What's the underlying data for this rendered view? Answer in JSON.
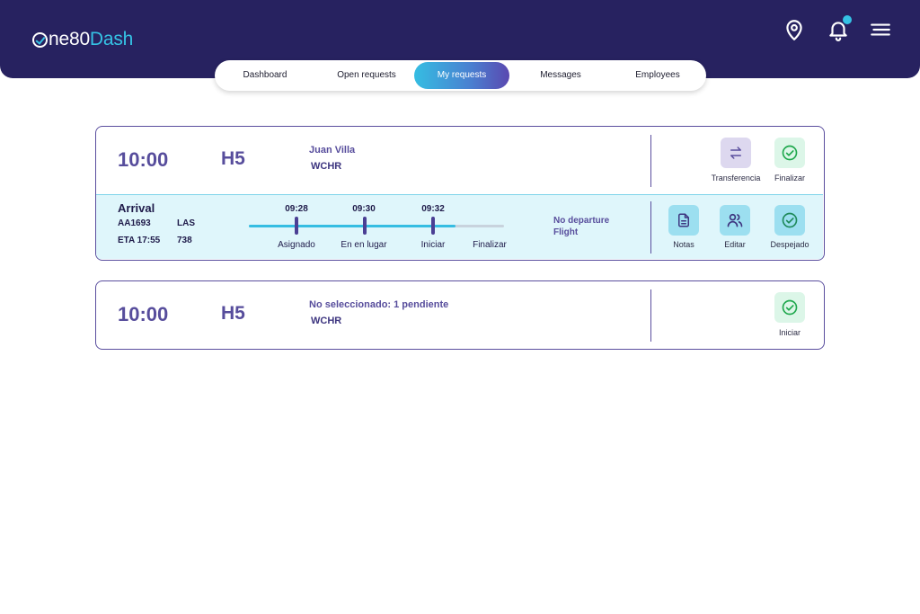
{
  "brand": {
    "logo_part1": "ne80",
    "logo_part2": "Dash"
  },
  "header_icons": {
    "location": "map-pin-icon",
    "notifications": "bell-icon",
    "menu": "hamburger-menu-icon"
  },
  "nav": {
    "tabs": [
      {
        "label": "Dashboard"
      },
      {
        "label": "Open requests"
      },
      {
        "label": "My requests",
        "active": true
      },
      {
        "label": "Messages"
      },
      {
        "label": "Employees"
      }
    ]
  },
  "requests": [
    {
      "time": "10:00",
      "gate": "H5",
      "passenger": "Juan Villa",
      "service": "WCHR",
      "actions": [
        {
          "label": "Transferencia",
          "icon": "transfer-arrows-icon"
        },
        {
          "label": "Finalizar",
          "icon": "check-circle-icon"
        }
      ],
      "detail": {
        "title": "Arrival",
        "flight": "AA1693",
        "origin": "LAS",
        "eta": "ETA 17:55",
        "code": "738",
        "progress_fraction": 0.81,
        "timeline": [
          {
            "time": "09:28",
            "stage": "Asignado"
          },
          {
            "time": "09:30",
            "stage": "En en lugar"
          },
          {
            "time": "09:32",
            "stage": "Iniciar"
          },
          {
            "time": "",
            "stage": "Finalizar"
          }
        ],
        "departure_note_line1": "No departure",
        "departure_note_line2": "Flight",
        "actions": [
          {
            "label": "Notas",
            "icon": "document-icon"
          },
          {
            "label": "Editar",
            "icon": "users-icon"
          },
          {
            "label": "Despejado",
            "icon": "check-circle-icon"
          }
        ]
      }
    },
    {
      "time": "10:00",
      "gate": "H5",
      "passenger": "No seleccionado: 1 pendiente",
      "service": "WCHR",
      "actions": [
        {
          "label": "Iniciar",
          "icon": "check-circle-icon"
        }
      ]
    }
  ],
  "colors": {
    "header_bg": "#272260",
    "accent_cyan": "#35c2e4",
    "card_border": "#5a4e9e",
    "detail_bg": "#dff6fb",
    "check_green": "#1fa84d"
  }
}
